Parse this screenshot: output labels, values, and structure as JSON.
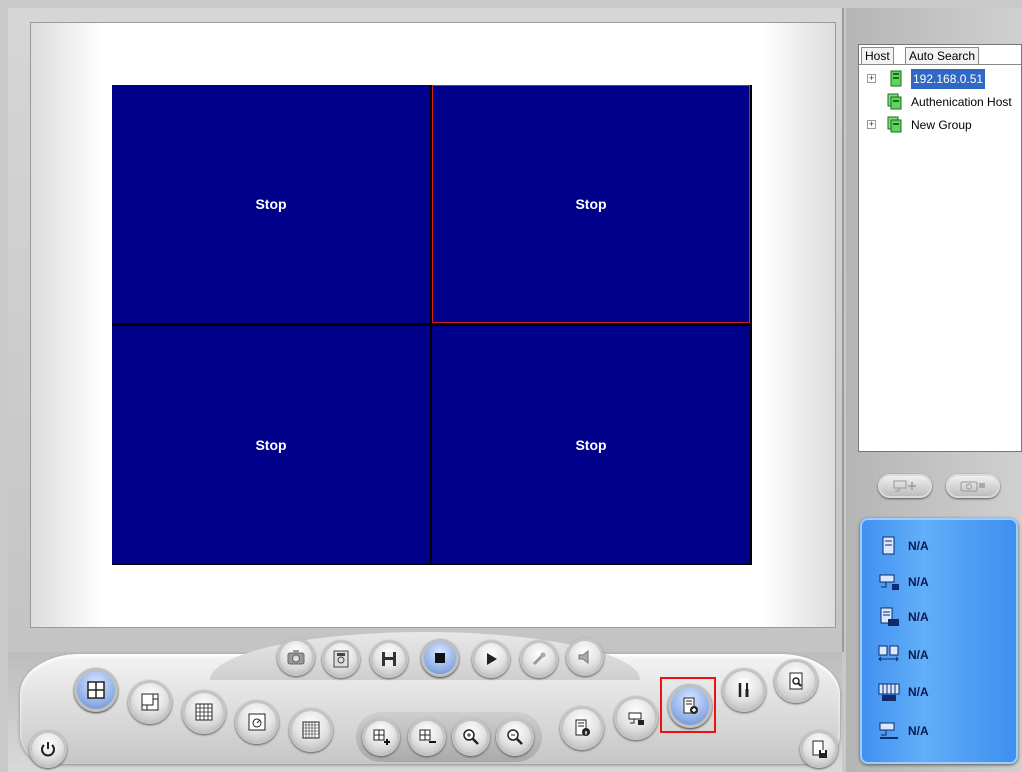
{
  "video_grid": {
    "cells": [
      {
        "status": "Stop"
      },
      {
        "status": "Stop"
      },
      {
        "status": "Stop"
      },
      {
        "status": "Stop"
      }
    ]
  },
  "host_tree": {
    "tabs": [
      "Host",
      "Auto Search"
    ],
    "items": [
      {
        "label": "192.168.0.51",
        "icon": "server-icon",
        "expandable": true,
        "selected": true
      },
      {
        "label": "Authenication Host",
        "icon": "host-group-icon",
        "expandable": false,
        "selected": false
      },
      {
        "label": "New Group",
        "icon": "host-group-icon",
        "expandable": true,
        "selected": false
      }
    ]
  },
  "status_panel": {
    "rows": [
      {
        "icon": "server-icon",
        "value": "N/A"
      },
      {
        "icon": "camera-icon",
        "value": "N/A"
      },
      {
        "icon": "ip-icon",
        "value": "N/A"
      },
      {
        "icon": "network-icon",
        "value": "N/A"
      },
      {
        "icon": "fps-icon",
        "value": "N/A"
      },
      {
        "icon": "record-camera-icon",
        "value": "N/A"
      }
    ]
  },
  "colors": {
    "video_bg": "#00008b",
    "selection_border": "#d02020",
    "tree_selection": "#3168c4",
    "status_panel": "#4a9af3",
    "highlight": "#e11111"
  }
}
